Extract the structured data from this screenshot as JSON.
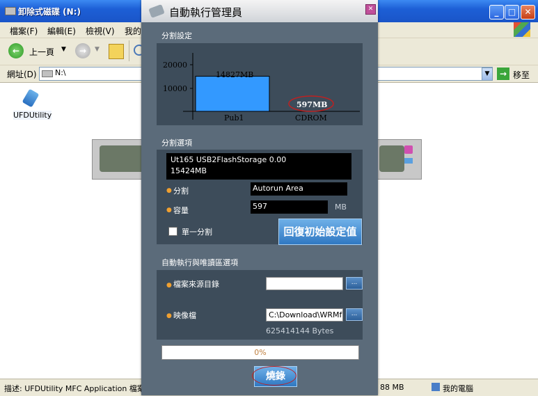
{
  "explorer": {
    "title": "卸除式磁碟 (N:)",
    "menu": [
      "檔案(F)",
      "編輯(E)",
      "檢視(V)",
      "我的"
    ],
    "toolbar": {
      "back_label": "上一頁"
    },
    "address": {
      "label": "網址(D)",
      "value": "N:\\",
      "go_label": "移至"
    },
    "file": {
      "name": "UFDUtility"
    },
    "status": {
      "description": "描述: UFDUtility MFC Application 檔案版",
      "size": "88 MB",
      "computer": "我的電腦"
    }
  },
  "dialog": {
    "title": "自動執行管理員",
    "partition_settings": {
      "heading": "分割設定",
      "y_ticks": [
        "20000",
        "10000"
      ],
      "bar_label": "14827MB",
      "highlight_label": "597MB",
      "categories": [
        "Pub1",
        "CDROM"
      ]
    },
    "partition_options": {
      "heading": "分割選項",
      "device_line1": "Ut165   USB2FlashStorage 0.00",
      "device_line2": "15424MB",
      "partition_label": "分割",
      "partition_value": "Autorun Area",
      "capacity_label": "容量",
      "capacity_value": "597",
      "capacity_unit": "MB",
      "single_label": "單一分割",
      "reset_label": "回復初始設定值"
    },
    "autorun": {
      "heading": "自動執行與唯讀區選項",
      "source_label": "檔案來源目錄",
      "source_value": "",
      "image_label": "映像檔",
      "image_value": "C:\\Download\\WRMf",
      "bytes": "625414144 Bytes",
      "browse": "..."
    },
    "progress": {
      "value": "0%",
      "fraction": 0
    },
    "burn_label": "燒錄"
  },
  "chart_data": {
    "type": "bar",
    "categories": [
      "Pub1",
      "CDROM"
    ],
    "values": [
      14827,
      597
    ],
    "data_labels": [
      "14827MB",
      "597MB"
    ],
    "yticks": [
      10000,
      20000
    ],
    "ylim": [
      0,
      25000
    ]
  }
}
